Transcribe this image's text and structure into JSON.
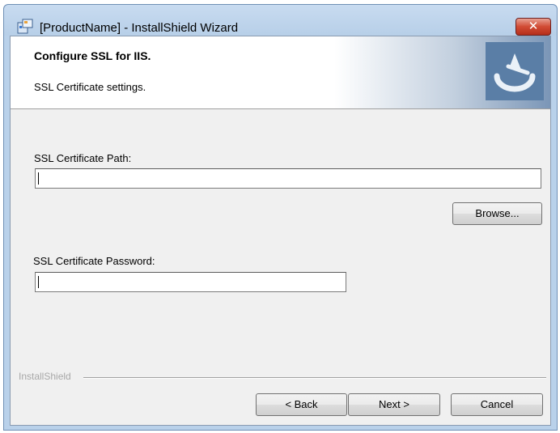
{
  "window": {
    "title": "[ProductName] - InstallShield Wizard",
    "close_label": "✕"
  },
  "banner": {
    "title": "Configure SSL for IIS.",
    "subtitle": "SSL Certificate settings."
  },
  "form": {
    "path_label": "SSL Certificate Path:",
    "path_value": "",
    "browse_label": "Browse...",
    "password_label": "SSL Certificate Password:",
    "password_value": ""
  },
  "footer": {
    "brand": "InstallShield",
    "back_label": "< Back",
    "next_label": "Next >",
    "cancel_label": "Cancel"
  },
  "icons": {
    "app": "installer-icon",
    "logo": "installshield-logo"
  }
}
